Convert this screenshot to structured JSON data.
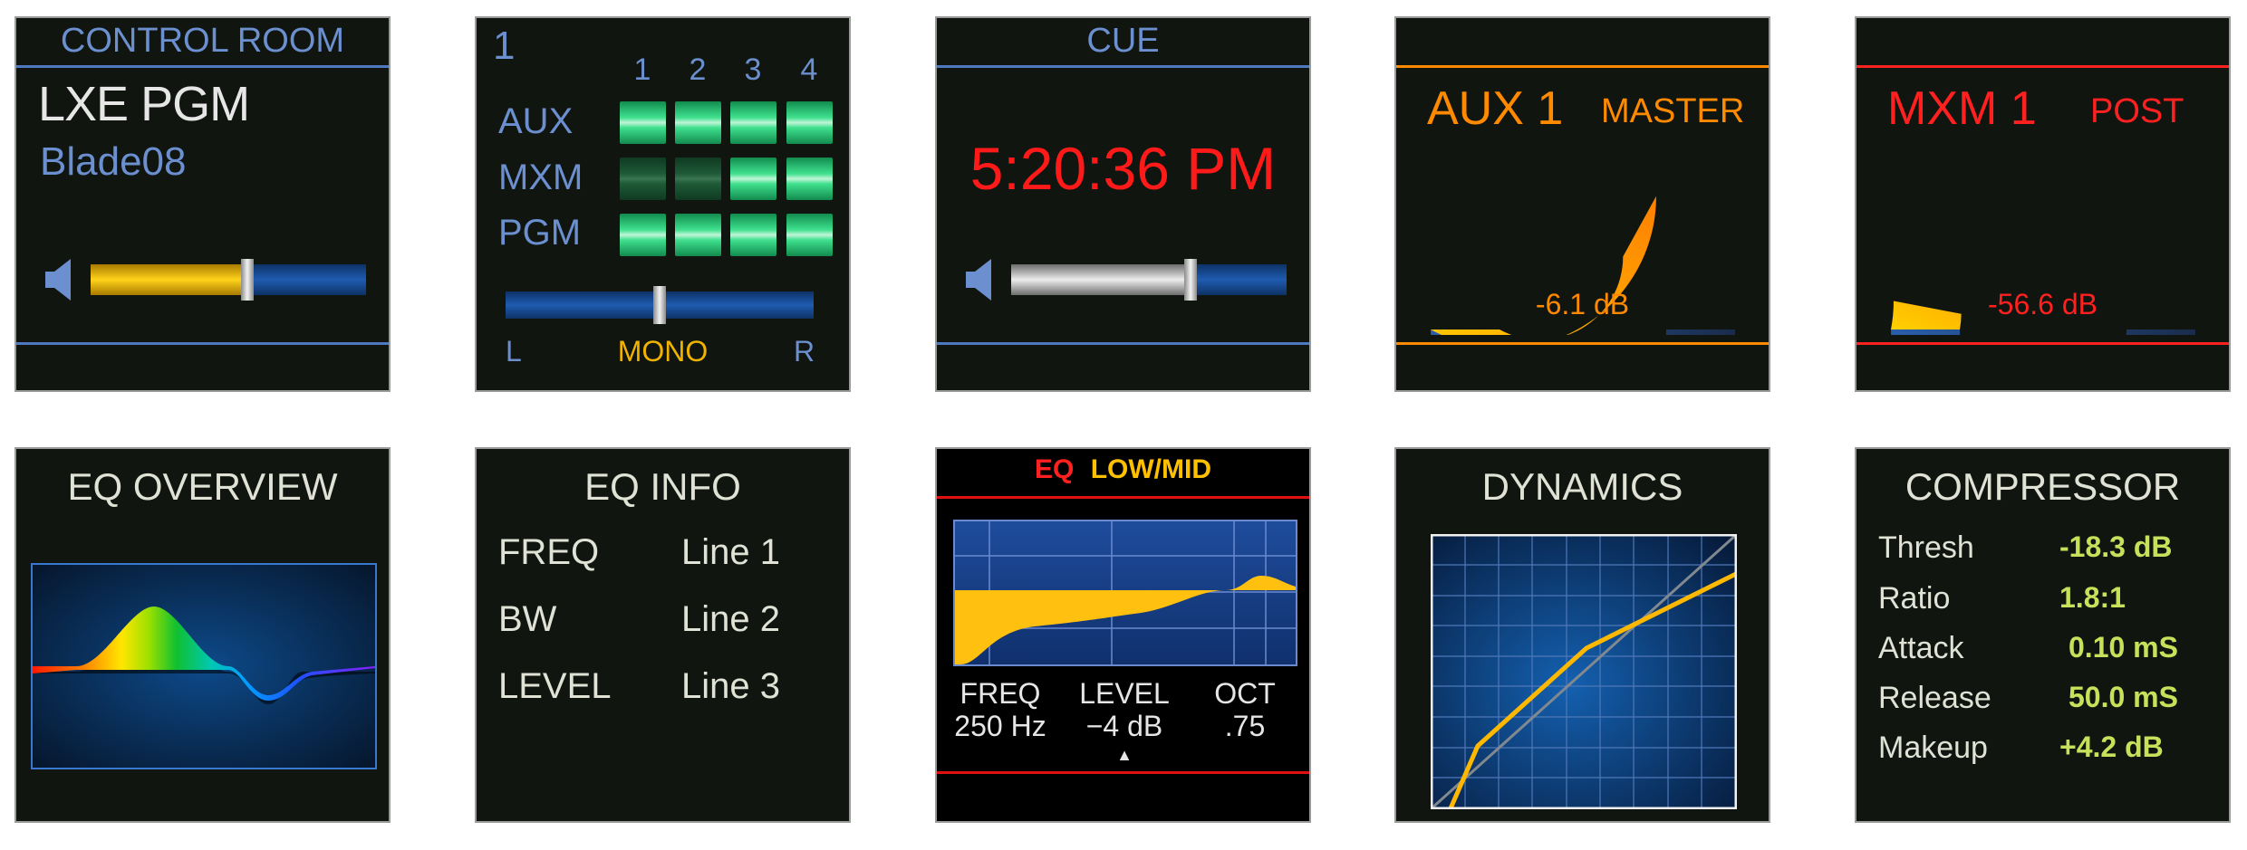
{
  "control_room": {
    "title": "CONTROL ROOM",
    "name": "LXE PGM",
    "device": "Blade08",
    "fader_level": 0.57
  },
  "assign": {
    "number": "1",
    "columns": [
      "1",
      "2",
      "3",
      "4"
    ],
    "rows": [
      {
        "label": "AUX",
        "states": [
          true,
          true,
          true,
          true
        ]
      },
      {
        "label": "MXM",
        "states": [
          false,
          false,
          true,
          true
        ]
      },
      {
        "label": "PGM",
        "states": [
          true,
          true,
          true,
          true
        ]
      }
    ],
    "pan_left": "L",
    "pan_center": "MONO",
    "pan_right": "R",
    "pan_position": 0.5
  },
  "cue": {
    "title": "CUE",
    "time": "5:20:36 PM",
    "fader_level": 0.65
  },
  "aux_meter": {
    "name": "AUX 1",
    "mode": "MASTER",
    "value": "-6.1 dB",
    "fill": 0.66,
    "color": "#ff8a00"
  },
  "mxm_meter": {
    "name": "MXM 1",
    "mode": "POST",
    "value": "-56.6 dB",
    "fill": 0.06,
    "color": "#ff2020"
  },
  "eq_overview": {
    "title": "EQ OVERVIEW"
  },
  "eq_info": {
    "title": "EQ INFO",
    "rows": [
      {
        "label": "FREQ",
        "value": "Line 1"
      },
      {
        "label": "BW",
        "value": "Line 2"
      },
      {
        "label": "LEVEL",
        "value": "Line 3"
      }
    ]
  },
  "eq_band": {
    "title_eq": "EQ",
    "title_band": "LOW/MID",
    "params": [
      {
        "label": "FREQ",
        "value": "250 Hz"
      },
      {
        "label": "LEVEL",
        "value": "−4 dB"
      },
      {
        "label": "OCT",
        "value": ".75"
      }
    ],
    "selected_marker": "▲"
  },
  "dynamics": {
    "title": "DYNAMICS"
  },
  "compressor": {
    "title": "COMPRESSOR",
    "rows": [
      {
        "label": "Thresh",
        "value": "-18.3 dB"
      },
      {
        "label": "Ratio",
        "value": "1.8:1"
      },
      {
        "label": "Attack",
        "value": "0.10 mS"
      },
      {
        "label": "Release",
        "value": "50.0 mS"
      },
      {
        "label": "Makeup",
        "value": "+4.2 dB"
      }
    ]
  },
  "colors": {
    "accent_blue": "#6b8fcf",
    "orange": "#ff8a00",
    "red": "#ff2020",
    "yellow": "#ffc000",
    "lime": "#c9e05a",
    "matrix_green": "#2fd27a"
  },
  "icons": [
    "speaker-icon"
  ]
}
